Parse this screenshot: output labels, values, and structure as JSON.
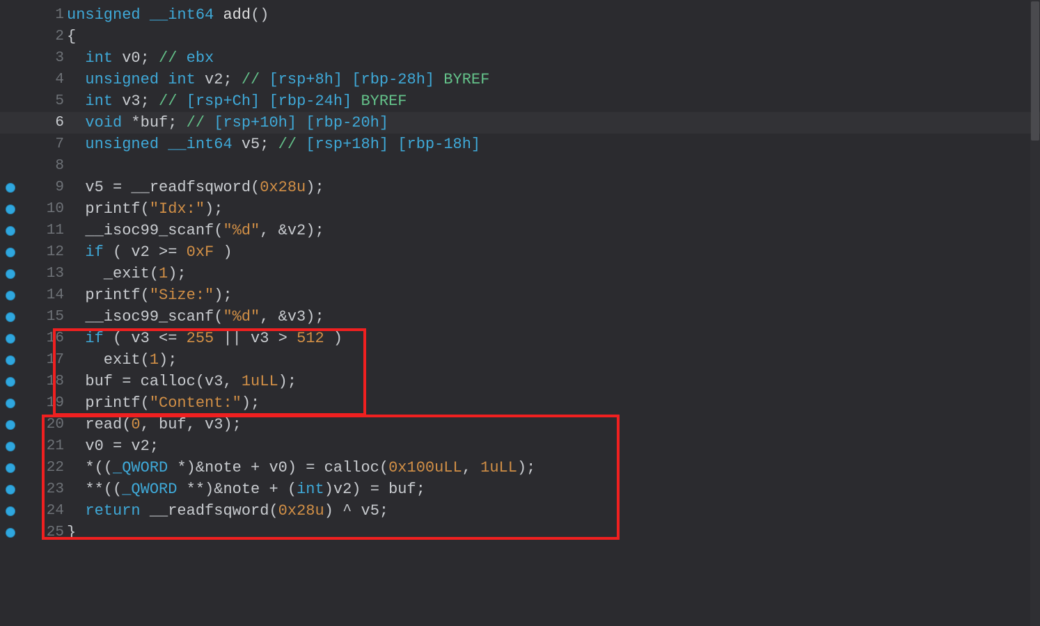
{
  "lines": [
    {
      "n": 1,
      "bp": false,
      "tokens": [
        {
          "c": "t-keyword",
          "t": "unsigned"
        },
        {
          "c": "t-default",
          "t": " "
        },
        {
          "c": "t-keyword",
          "t": "__int64"
        },
        {
          "c": "t-default",
          "t": " "
        },
        {
          "c": "t-func",
          "t": "add"
        },
        {
          "c": "t-punct",
          "t": "()"
        }
      ]
    },
    {
      "n": 2,
      "bp": false,
      "tokens": [
        {
          "c": "t-punct",
          "t": "{"
        }
      ]
    },
    {
      "n": 3,
      "bp": false,
      "tokens": [
        {
          "c": "t-default",
          "t": "  "
        },
        {
          "c": "t-keyword",
          "t": "int"
        },
        {
          "c": "t-default",
          "t": " v0; "
        },
        {
          "c": "t-comment",
          "t": "// "
        },
        {
          "c": "t-commkw",
          "t": "ebx"
        }
      ]
    },
    {
      "n": 4,
      "bp": false,
      "tokens": [
        {
          "c": "t-default",
          "t": "  "
        },
        {
          "c": "t-keyword",
          "t": "unsigned"
        },
        {
          "c": "t-default",
          "t": " "
        },
        {
          "c": "t-keyword",
          "t": "int"
        },
        {
          "c": "t-default",
          "t": " v2; "
        },
        {
          "c": "t-comment",
          "t": "// "
        },
        {
          "c": "t-commkw",
          "t": "[rsp+8h] [rbp-28h]"
        },
        {
          "c": "t-comment",
          "t": " BYREF"
        }
      ]
    },
    {
      "n": 5,
      "bp": false,
      "tokens": [
        {
          "c": "t-default",
          "t": "  "
        },
        {
          "c": "t-keyword",
          "t": "int"
        },
        {
          "c": "t-default",
          "t": " v3; "
        },
        {
          "c": "t-comment",
          "t": "// "
        },
        {
          "c": "t-commkw",
          "t": "[rsp+Ch] [rbp-24h]"
        },
        {
          "c": "t-comment",
          "t": " BYREF"
        }
      ]
    },
    {
      "n": 6,
      "bp": false,
      "cursor": true,
      "tokens": [
        {
          "c": "t-default",
          "t": "  "
        },
        {
          "c": "t-keyword",
          "t": "void"
        },
        {
          "c": "t-default",
          "t": " *buf; "
        },
        {
          "c": "t-comment",
          "t": "// "
        },
        {
          "c": "t-commkw",
          "t": "[rsp+10h] [rbp-20h]"
        }
      ]
    },
    {
      "n": 7,
      "bp": false,
      "tokens": [
        {
          "c": "t-default",
          "t": "  "
        },
        {
          "c": "t-keyword",
          "t": "unsigned"
        },
        {
          "c": "t-default",
          "t": " "
        },
        {
          "c": "t-keyword",
          "t": "__int64"
        },
        {
          "c": "t-default",
          "t": " v5; "
        },
        {
          "c": "t-comment",
          "t": "// "
        },
        {
          "c": "t-commkw",
          "t": "[rsp+18h] [rbp-18h]"
        }
      ]
    },
    {
      "n": 8,
      "bp": false,
      "tokens": [
        {
          "c": "t-default",
          "t": ""
        }
      ]
    },
    {
      "n": 9,
      "bp": true,
      "tokens": [
        {
          "c": "t-default",
          "t": "  v5 = __readfsqword("
        },
        {
          "c": "t-num",
          "t": "0x28u"
        },
        {
          "c": "t-default",
          "t": ");"
        }
      ]
    },
    {
      "n": 10,
      "bp": true,
      "tokens": [
        {
          "c": "t-default",
          "t": "  printf("
        },
        {
          "c": "t-string",
          "t": "\"Idx:\""
        },
        {
          "c": "t-default",
          "t": ");"
        }
      ]
    },
    {
      "n": 11,
      "bp": true,
      "tokens": [
        {
          "c": "t-default",
          "t": "  __isoc99_scanf("
        },
        {
          "c": "t-string",
          "t": "\"%d\""
        },
        {
          "c": "t-default",
          "t": ", &v2);"
        }
      ]
    },
    {
      "n": 12,
      "bp": true,
      "tokens": [
        {
          "c": "t-default",
          "t": "  "
        },
        {
          "c": "t-keyword",
          "t": "if"
        },
        {
          "c": "t-default",
          "t": " ( v2 >= "
        },
        {
          "c": "t-num",
          "t": "0xF"
        },
        {
          "c": "t-default",
          "t": " )"
        }
      ]
    },
    {
      "n": 13,
      "bp": true,
      "tokens": [
        {
          "c": "t-default",
          "t": "    _exit("
        },
        {
          "c": "t-num",
          "t": "1"
        },
        {
          "c": "t-default",
          "t": ");"
        }
      ]
    },
    {
      "n": 14,
      "bp": true,
      "tokens": [
        {
          "c": "t-default",
          "t": "  printf("
        },
        {
          "c": "t-string",
          "t": "\"Size:\""
        },
        {
          "c": "t-default",
          "t": ");"
        }
      ]
    },
    {
      "n": 15,
      "bp": true,
      "tokens": [
        {
          "c": "t-default",
          "t": "  __isoc99_scanf("
        },
        {
          "c": "t-string",
          "t": "\"%d\""
        },
        {
          "c": "t-default",
          "t": ", &v3);"
        }
      ]
    },
    {
      "n": 16,
      "bp": true,
      "tokens": [
        {
          "c": "t-default",
          "t": "  "
        },
        {
          "c": "t-keyword",
          "t": "if"
        },
        {
          "c": "t-default",
          "t": " ( v3 <= "
        },
        {
          "c": "t-num",
          "t": "255"
        },
        {
          "c": "t-default",
          "t": " || v3 > "
        },
        {
          "c": "t-num",
          "t": "512"
        },
        {
          "c": "t-default",
          "t": " )"
        }
      ]
    },
    {
      "n": 17,
      "bp": true,
      "tokens": [
        {
          "c": "t-default",
          "t": "    exit("
        },
        {
          "c": "t-num",
          "t": "1"
        },
        {
          "c": "t-default",
          "t": ");"
        }
      ]
    },
    {
      "n": 18,
      "bp": true,
      "tokens": [
        {
          "c": "t-default",
          "t": "  buf = calloc(v3, "
        },
        {
          "c": "t-num",
          "t": "1uLL"
        },
        {
          "c": "t-default",
          "t": ");"
        }
      ]
    },
    {
      "n": 19,
      "bp": true,
      "tokens": [
        {
          "c": "t-default",
          "t": "  printf("
        },
        {
          "c": "t-string",
          "t": "\"Content:\""
        },
        {
          "c": "t-default",
          "t": ");"
        }
      ]
    },
    {
      "n": 20,
      "bp": true,
      "tokens": [
        {
          "c": "t-default",
          "t": "  read("
        },
        {
          "c": "t-num",
          "t": "0"
        },
        {
          "c": "t-default",
          "t": ", buf, v3);"
        }
      ]
    },
    {
      "n": 21,
      "bp": true,
      "tokens": [
        {
          "c": "t-default",
          "t": "  v0 = v2;"
        }
      ]
    },
    {
      "n": 22,
      "bp": true,
      "tokens": [
        {
          "c": "t-default",
          "t": "  *(("
        },
        {
          "c": "t-keyword",
          "t": "_QWORD"
        },
        {
          "c": "t-default",
          "t": " *)&note + v0) = calloc("
        },
        {
          "c": "t-num",
          "t": "0x100uLL"
        },
        {
          "c": "t-default",
          "t": ", "
        },
        {
          "c": "t-num",
          "t": "1uLL"
        },
        {
          "c": "t-default",
          "t": ");"
        }
      ]
    },
    {
      "n": 23,
      "bp": true,
      "tokens": [
        {
          "c": "t-default",
          "t": "  **(("
        },
        {
          "c": "t-keyword",
          "t": "_QWORD"
        },
        {
          "c": "t-default",
          "t": " **)&note + ("
        },
        {
          "c": "t-keyword",
          "t": "int"
        },
        {
          "c": "t-default",
          "t": ")v2) = buf;"
        }
      ]
    },
    {
      "n": 24,
      "bp": true,
      "tokens": [
        {
          "c": "t-default",
          "t": "  "
        },
        {
          "c": "t-keyword",
          "t": "return"
        },
        {
          "c": "t-default",
          "t": " __readfsqword("
        },
        {
          "c": "t-num",
          "t": "0x28u"
        },
        {
          "c": "t-default",
          "t": ") ^ v5;"
        }
      ]
    },
    {
      "n": 25,
      "bp": true,
      "tokens": [
        {
          "c": "t-punct",
          "t": "}"
        }
      ]
    }
  ]
}
